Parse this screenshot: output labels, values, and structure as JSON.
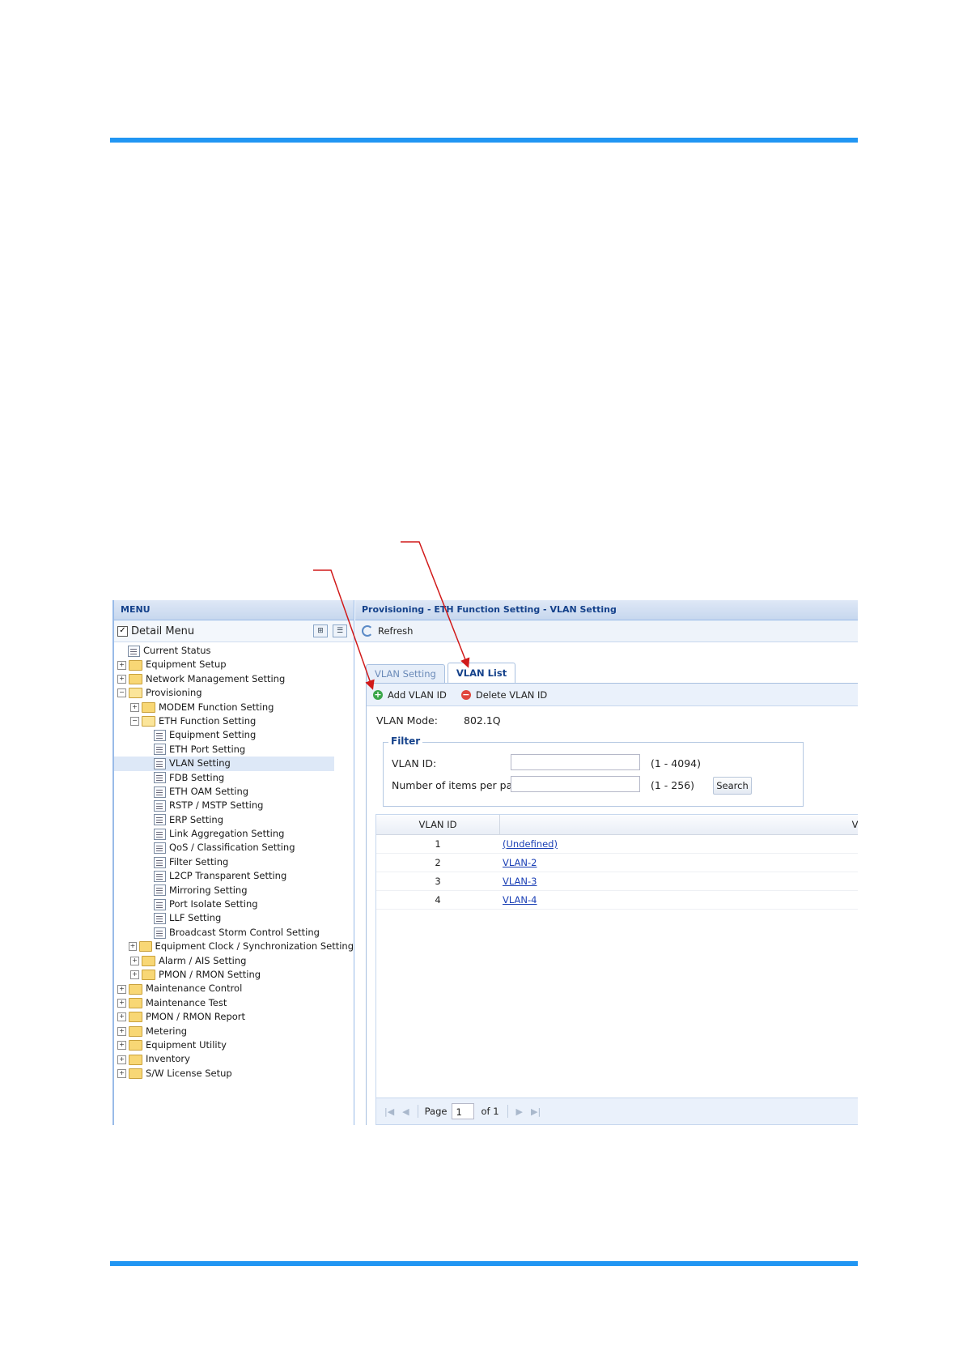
{
  "menu": {
    "title": "MENU",
    "detail_menu_label": "Detail Menu",
    "detail_menu_checked": true,
    "items": [
      {
        "label": "Current Status",
        "type": "leaf",
        "level": 0
      },
      {
        "label": "Equipment Setup",
        "type": "folder",
        "level": 0,
        "expanded": false
      },
      {
        "label": "Network Management Setting",
        "type": "folder",
        "level": 0,
        "expanded": false
      },
      {
        "label": "Provisioning",
        "type": "folder",
        "level": 0,
        "expanded": true
      },
      {
        "label": "MODEM Function Setting",
        "type": "folder",
        "level": 1,
        "expanded": false
      },
      {
        "label": "ETH Function Setting",
        "type": "folder",
        "level": 1,
        "expanded": true
      },
      {
        "label": "Equipment Setting",
        "type": "leaf",
        "level": 2
      },
      {
        "label": "ETH Port Setting",
        "type": "leaf",
        "level": 2
      },
      {
        "label": "VLAN Setting",
        "type": "leaf",
        "level": 2,
        "selected": true
      },
      {
        "label": "FDB Setting",
        "type": "leaf",
        "level": 2
      },
      {
        "label": "ETH OAM Setting",
        "type": "leaf",
        "level": 2
      },
      {
        "label": "RSTP / MSTP Setting",
        "type": "leaf",
        "level": 2
      },
      {
        "label": "ERP Setting",
        "type": "leaf",
        "level": 2
      },
      {
        "label": "Link Aggregation Setting",
        "type": "leaf",
        "level": 2
      },
      {
        "label": "QoS / Classification Setting",
        "type": "leaf",
        "level": 2
      },
      {
        "label": "Filter Setting",
        "type": "leaf",
        "level": 2
      },
      {
        "label": "L2CP Transparent Setting",
        "type": "leaf",
        "level": 2
      },
      {
        "label": "Mirroring Setting",
        "type": "leaf",
        "level": 2
      },
      {
        "label": "Port Isolate Setting",
        "type": "leaf",
        "level": 2
      },
      {
        "label": "LLF Setting",
        "type": "leaf",
        "level": 2
      },
      {
        "label": "Broadcast Storm Control Setting",
        "type": "leaf",
        "level": 2
      },
      {
        "label": "Equipment Clock / Synchronization Setting",
        "type": "folder",
        "level": 1,
        "expanded": false
      },
      {
        "label": "Alarm / AIS Setting",
        "type": "folder",
        "level": 1,
        "expanded": false
      },
      {
        "label": "PMON / RMON Setting",
        "type": "folder",
        "level": 1,
        "expanded": false
      },
      {
        "label": "Maintenance Control",
        "type": "folder",
        "level": 0,
        "expanded": false
      },
      {
        "label": "Maintenance Test",
        "type": "folder",
        "level": 0,
        "expanded": false
      },
      {
        "label": "PMON / RMON Report",
        "type": "folder",
        "level": 0,
        "expanded": false
      },
      {
        "label": "Metering",
        "type": "folder",
        "level": 0,
        "expanded": false
      },
      {
        "label": "Equipment Utility",
        "type": "folder",
        "level": 0,
        "expanded": false
      },
      {
        "label": "Inventory",
        "type": "folder",
        "level": 0,
        "expanded": false
      },
      {
        "label": "S/W License Setup",
        "type": "folder",
        "level": 0,
        "expanded": false
      }
    ]
  },
  "content": {
    "breadcrumb": "Provisioning - ETH Function Setting - VLAN Setting",
    "refresh_label": "Refresh",
    "tabs": [
      {
        "label": "VLAN Setting",
        "active": false
      },
      {
        "label": "VLAN List",
        "active": true
      }
    ],
    "add_label": "Add VLAN ID",
    "delete_label": "Delete VLAN ID",
    "vlan_mode_label": "VLAN Mode:",
    "vlan_mode_value": "802.1Q",
    "filter": {
      "legend": "Filter",
      "vlan_id_label": "VLAN ID:",
      "vlan_id_value": "",
      "vlan_id_range": "(1 - 4094)",
      "items_label": "Number of items per page:",
      "items_value": "",
      "items_range": "(1 - 256)",
      "search_label": "Search"
    },
    "grid": {
      "columns": [
        "VLAN ID",
        "VLA"
      ],
      "rows": [
        {
          "id": "1",
          "name": "(Undefined)"
        },
        {
          "id": "2",
          "name": "VLAN-2"
        },
        {
          "id": "3",
          "name": "VLAN-3"
        },
        {
          "id": "4",
          "name": "VLAN-4"
        }
      ]
    },
    "pager": {
      "page_label": "Page",
      "page_value": "1",
      "of_label": "of 1"
    }
  },
  "colors": {
    "rule": "#2196f3",
    "annotation_arrow": "#d11a1a",
    "header_text": "#15428b"
  }
}
